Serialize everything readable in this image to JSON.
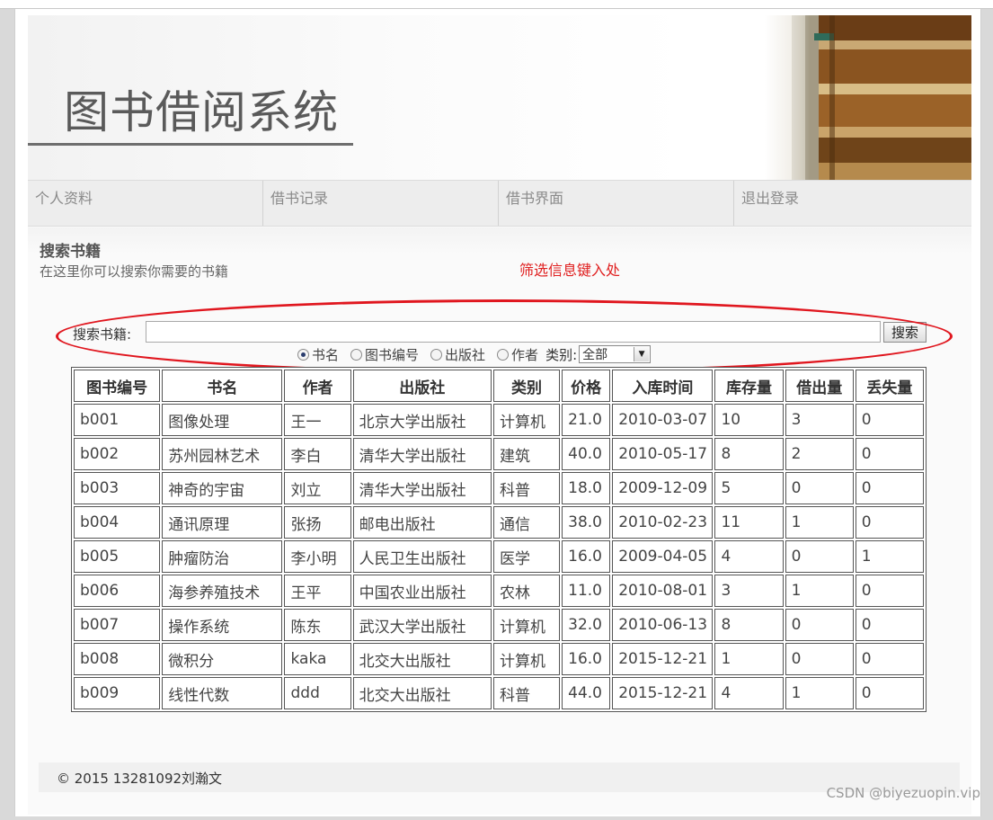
{
  "banner": {
    "title": "图书借阅系统"
  },
  "nav": {
    "items": [
      "个人资料",
      "借书记录",
      "借书界面",
      "退出登录"
    ]
  },
  "section": {
    "title": "搜索书籍",
    "desc": "在这里你可以搜索你需要的书籍",
    "annotation": "筛选信息键入处"
  },
  "search": {
    "label": "搜索书籍:",
    "value": "",
    "button": "搜索",
    "options": [
      "书名",
      "图书编号",
      "出版社",
      "作者"
    ],
    "selected_option": "书名",
    "category_label": "类别:",
    "category_value": "全部"
  },
  "table": {
    "headers": [
      "图书编号",
      "书名",
      "作者",
      "出版社",
      "类别",
      "价格",
      "入库时间",
      "库存量",
      "借出量",
      "丢失量"
    ],
    "rows": [
      [
        "b001",
        "图像处理",
        "王一",
        "北京大学出版社",
        "计算机",
        "21.0",
        "2010-03-07",
        "10",
        "3",
        "0"
      ],
      [
        "b002",
        "苏州园林艺术",
        "李白",
        "清华大学出版社",
        "建筑",
        "40.0",
        "2010-05-17",
        "8",
        "2",
        "0"
      ],
      [
        "b003",
        "神奇的宇宙",
        "刘立",
        "清华大学出版社",
        "科普",
        "18.0",
        "2009-12-09",
        "5",
        "0",
        "0"
      ],
      [
        "b004",
        "通讯原理",
        "张扬",
        "邮电出版社",
        "通信",
        "38.0",
        "2010-02-23",
        "11",
        "1",
        "0"
      ],
      [
        "b005",
        "肿瘤防治",
        "李小明",
        "人民卫生出版社",
        "医学",
        "16.0",
        "2009-04-05",
        "4",
        "0",
        "1"
      ],
      [
        "b006",
        "海参养殖技术",
        "王平",
        "中国农业出版社",
        "农林",
        "11.0",
        "2010-08-01",
        "3",
        "1",
        "0"
      ],
      [
        "b007",
        "操作系统",
        "陈东",
        "武汉大学出版社",
        "计算机",
        "32.0",
        "2010-06-13",
        "8",
        "0",
        "0"
      ],
      [
        "b008",
        "微积分",
        "kaka",
        "北交大出版社",
        "计算机",
        "16.0",
        "2015-12-21",
        "1",
        "0",
        "0"
      ],
      [
        "b009",
        "线性代数",
        "ddd",
        "北交大出版社",
        "科普",
        "44.0",
        "2015-12-21",
        "4",
        "1",
        "0"
      ]
    ]
  },
  "footer": {
    "text": "© 2015  13281092刘瀚文"
  },
  "watermark": "CSDN @biyezuopin.vip",
  "colors": {
    "annotation": "#e02020",
    "ellipse": "#e0161e"
  }
}
